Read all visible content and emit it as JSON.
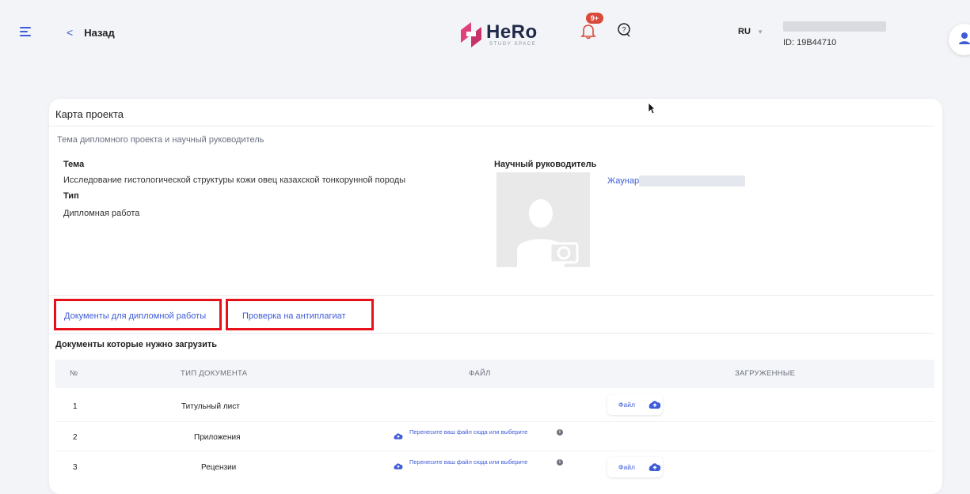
{
  "header": {
    "back_label": "Назад",
    "logo_text": "HeRo",
    "logo_sub": "STUDY SPACE",
    "notifications_badge": "9+",
    "language": "RU",
    "user_id": "ID: 19B44710"
  },
  "card": {
    "title": "Карта проекта",
    "section_subtitle": "Тема дипломного проекта и научный руководитель",
    "theme_label": "Тема",
    "theme_value": "Исследование гистологической структуры кожи овец казахской тонкорунной породы",
    "type_label": "Тип",
    "type_value": "Дипломная работа",
    "supervisor_label": "Научный руководитель",
    "supervisor_name": "Жаунар"
  },
  "tabs": [
    {
      "label": "Документы для дипломной работы"
    },
    {
      "label": "Проверка на антиплагиат"
    }
  ],
  "documents": {
    "title": "Документы которые нужно загрузить",
    "columns": [
      "№",
      "ТИП ДОКУМЕНТА",
      "ФАЙЛ",
      "ЗАГРУЖЕННЫЕ"
    ],
    "dropzone_text": "Перенесите ваш файл сюда или выберите",
    "file_button_label": "Файл",
    "rows": [
      {
        "num": "1",
        "type": "Титульный лист"
      },
      {
        "num": "2",
        "type": "Приложения"
      },
      {
        "num": "3",
        "type": "Рецензии"
      }
    ]
  },
  "colors": {
    "accent": "#3e5bd8",
    "highlight": "#e8101b",
    "badge": "#d94a3a"
  }
}
